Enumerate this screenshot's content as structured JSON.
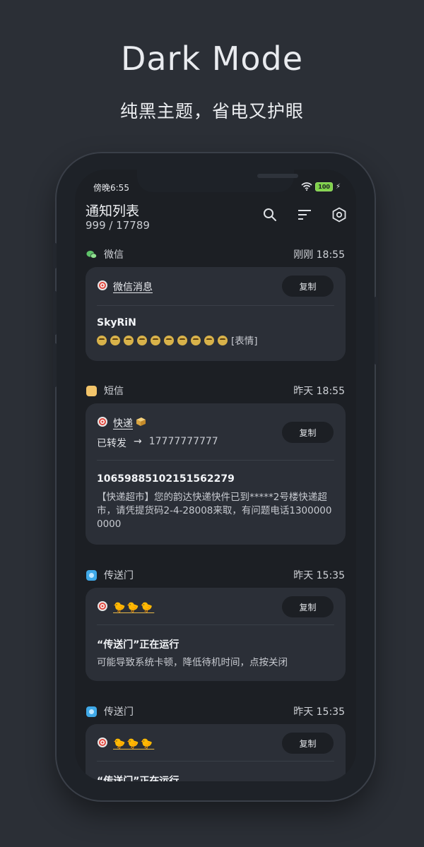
{
  "hero": {
    "title": "Dark Mode",
    "subtitle": "纯黑主题，省电又护眼"
  },
  "status_bar": {
    "time": "傍晚6:55",
    "battery": "100"
  },
  "app": {
    "title": "通知列表",
    "count": "999 / 17789",
    "icons": [
      "search-icon",
      "sort-icon",
      "settings-icon"
    ]
  },
  "groups": [
    {
      "app_name": "微信",
      "time": "刚刚 18:55",
      "icon": "wechat-icon",
      "card": {
        "title": "微信消息",
        "copy_label": "复制",
        "sender": "SkyRiN",
        "body": "[表情]"
      }
    },
    {
      "app_name": "短信",
      "time": "昨天 18:55",
      "icon": "sms-icon",
      "card": {
        "title": "快递",
        "copy_label": "复制",
        "forward_label": "已转发",
        "forward_arrow": "→",
        "forward_number": "17777777777",
        "sender": "10659885102151562279",
        "body": "【快递超市】您的韵达快递快件已到*****2号楼快递超市，请凭提货码2-4-28008来取，有问题电话13000000000"
      }
    },
    {
      "app_name": "传送门",
      "time": "昨天 15:35",
      "icon": "portal-icon",
      "card": {
        "copy_label": "复制",
        "sender": "“传送门”正在运行",
        "body": "可能导致系统卡顿，降低待机时间，点按关闭"
      }
    },
    {
      "app_name": "传送门",
      "time": "昨天 15:35",
      "icon": "portal-icon",
      "card": {
        "copy_label": "复制",
        "sender": "“传送门”正在运行"
      }
    }
  ]
}
